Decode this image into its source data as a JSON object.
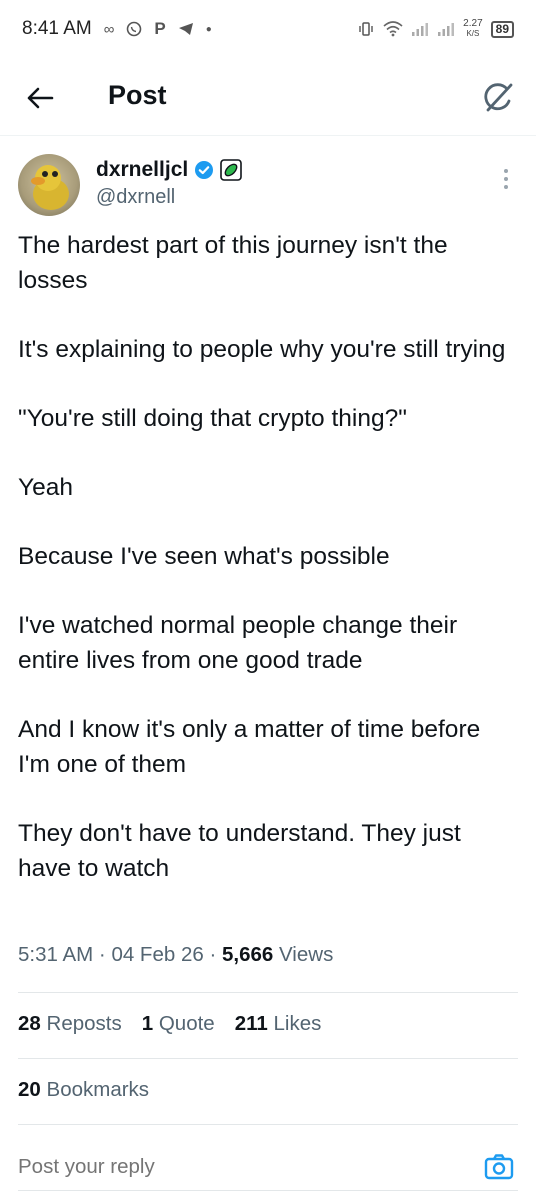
{
  "status_bar": {
    "time": "8:41 AM",
    "net_speed_value": "2.27",
    "net_speed_unit": "K/S",
    "battery": "89"
  },
  "header": {
    "title": "Post"
  },
  "author": {
    "display_name": "dxrnelljcl",
    "handle": "@dxrnell"
  },
  "tweet": {
    "paragraphs": [
      "The hardest part of this journey isn't the losses",
      "It's explaining to people why you're still trying",
      "\"You're still doing that crypto thing?\"",
      "Yeah",
      "Because I've seen what's possible",
      "I've watched normal people change their entire lives from one good trade",
      "And I know it's only a matter of time before I'm one of them",
      "They don't have to understand. They just have to watch"
    ],
    "time": "5:31 AM",
    "date": "04 Feb 26",
    "views_count": "5,666",
    "views_label": "Views"
  },
  "stats": {
    "reposts_count": "28",
    "reposts_label": "Reposts",
    "quotes_count": "1",
    "quotes_label": "Quote",
    "likes_count": "211",
    "likes_label": "Likes",
    "bookmarks_count": "20",
    "bookmarks_label": "Bookmarks"
  },
  "reply": {
    "placeholder": "Post your reply"
  },
  "colors": {
    "verified_blue": "#1d9bf0",
    "text_primary": "#0f1419",
    "text_secondary": "#536471",
    "divider": "#e3e7e9",
    "camera_icon": "#1d9bf0"
  },
  "icons": {
    "back": "arrow-left-icon",
    "grok": "grok-icon",
    "verified": "verified-badge-icon",
    "affiliate": "affiliate-badge-icon",
    "more": "more-vertical-icon",
    "camera": "camera-icon"
  }
}
